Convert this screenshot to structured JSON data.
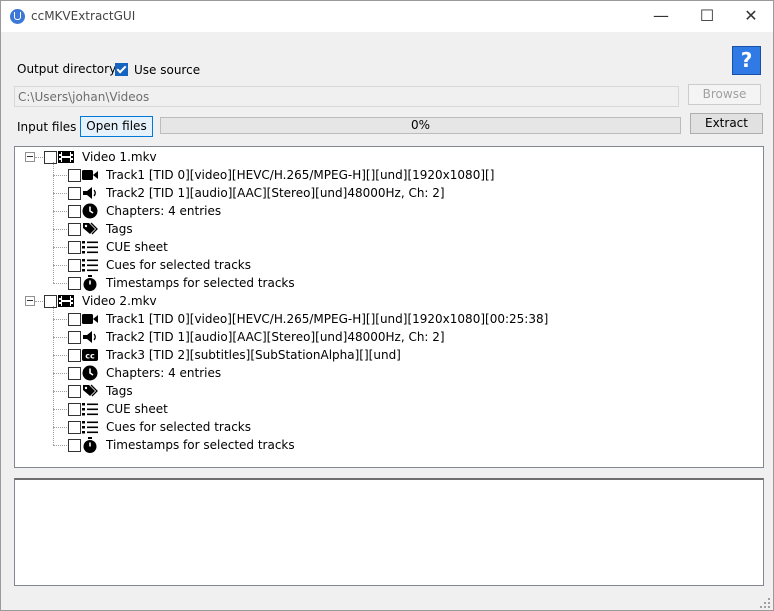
{
  "window": {
    "title": "ccMKVExtractGUI",
    "controls": {
      "minimize": "—",
      "maximize": "☐",
      "close": "✕"
    }
  },
  "help": {
    "label": "?",
    "icon": "help-icon",
    "color": "#2f7ae5"
  },
  "output": {
    "label": "Output directory",
    "use_source_label": "Use source",
    "use_source_checked": true,
    "path_value": "C:\\Users\\johan\\Videos",
    "browse_label": "Browse"
  },
  "input": {
    "label": "Input files",
    "open_label": "Open files",
    "extract_label": "Extract"
  },
  "progress": {
    "text": "0%",
    "value": 0
  },
  "tree": {
    "files": [
      {
        "name": "Video 1.mkv",
        "icon": "film-icon",
        "items": [
          {
            "icon": "video-camera-icon",
            "label": "Track1 [TID 0][video][HEVC/H.265/MPEG-H][][und][1920x1080][]"
          },
          {
            "icon": "speaker-icon",
            "label": "Track2 [TID 1][audio][AAC][Stereo][und]48000Hz, Ch: 2]"
          },
          {
            "icon": "clock-icon",
            "label": "Chapters: 4 entries"
          },
          {
            "icon": "tags-icon",
            "label": "Tags"
          },
          {
            "icon": "list-icon",
            "label": "CUE sheet"
          },
          {
            "icon": "list-icon",
            "label": "Cues for selected tracks"
          },
          {
            "icon": "stopwatch-icon",
            "label": "Timestamps for selected tracks"
          }
        ]
      },
      {
        "name": "Video 2.mkv",
        "icon": "film-icon",
        "items": [
          {
            "icon": "video-camera-icon",
            "label": "Track1 [TID 0][video][HEVC/H.265/MPEG-H][][und][1920x1080][00:25:38]"
          },
          {
            "icon": "speaker-icon",
            "label": "Track2 [TID 1][audio][AAC][Stereo][und]48000Hz, Ch: 2]"
          },
          {
            "icon": "cc-icon",
            "label": "Track3 [TID 2][subtitles][SubStationAlpha][][und]"
          },
          {
            "icon": "clock-icon",
            "label": "Chapters: 4 entries"
          },
          {
            "icon": "tags-icon",
            "label": "Tags"
          },
          {
            "icon": "list-icon",
            "label": "CUE sheet"
          },
          {
            "icon": "list-icon",
            "label": "Cues for selected tracks"
          },
          {
            "icon": "stopwatch-icon",
            "label": "Timestamps for selected tracks"
          }
        ]
      }
    ]
  },
  "log": {
    "text": ""
  }
}
